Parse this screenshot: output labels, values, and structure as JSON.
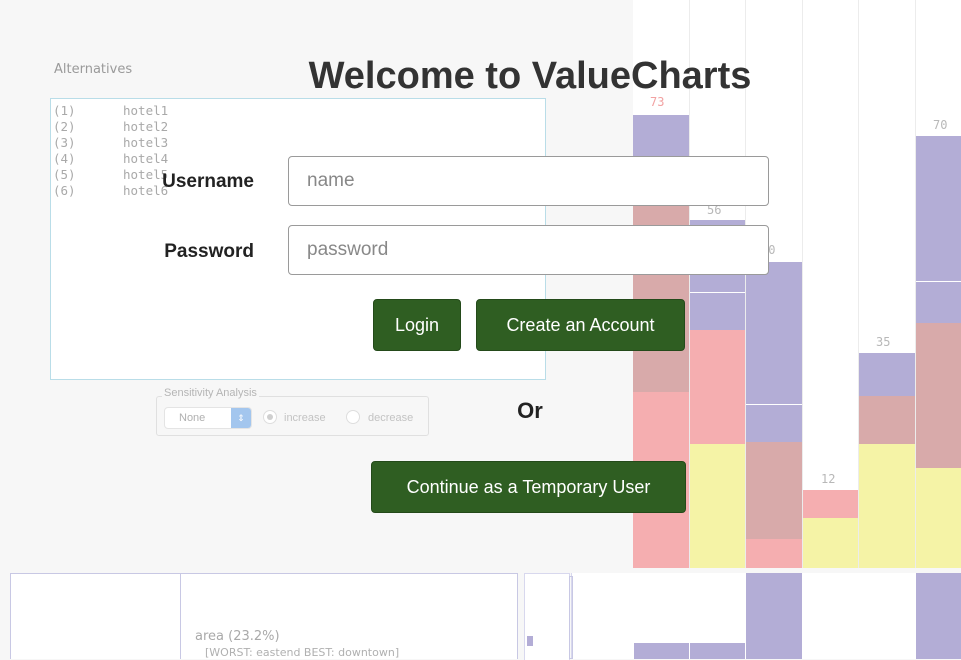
{
  "login": {
    "title": "Welcome to ValueCharts",
    "username_label": "Username",
    "username_placeholder": "name",
    "password_label": "Password",
    "password_placeholder": "password",
    "login_button": "Login",
    "create_account_button": "Create an Account",
    "or_text": "Or",
    "temporary_user_button": "Continue as a Temporary User",
    "button_color": "#2f5e22"
  },
  "alternatives": {
    "title": "Alternatives",
    "items": [
      {
        "num": "(1)",
        "name": "hotel1"
      },
      {
        "num": "(2)",
        "name": "hotel2"
      },
      {
        "num": "(3)",
        "name": "hotel3"
      },
      {
        "num": "(4)",
        "name": "hotel4"
      },
      {
        "num": "(5)",
        "name": "hotel5"
      },
      {
        "num": "(6)",
        "name": "hotel6"
      }
    ]
  },
  "sensitivity": {
    "legend": "Sensitivity Analysis",
    "selected": "None",
    "option_increase": "increase",
    "option_decrease": "decrease",
    "checked": "increase"
  },
  "objective": {
    "name": "area (23.2%)",
    "range": "[WORST: eastend BEST: downtown]"
  },
  "score_labels": [
    "73",
    "56",
    "20",
    "12",
    "35",
    "70"
  ],
  "colors": {
    "lavender": "#b3add6",
    "mauve": "#d8aaaa",
    "pink": "#f5aeb0",
    "yellow": "#f5f3a6",
    "highlight_label": "#f2a2a2"
  }
}
